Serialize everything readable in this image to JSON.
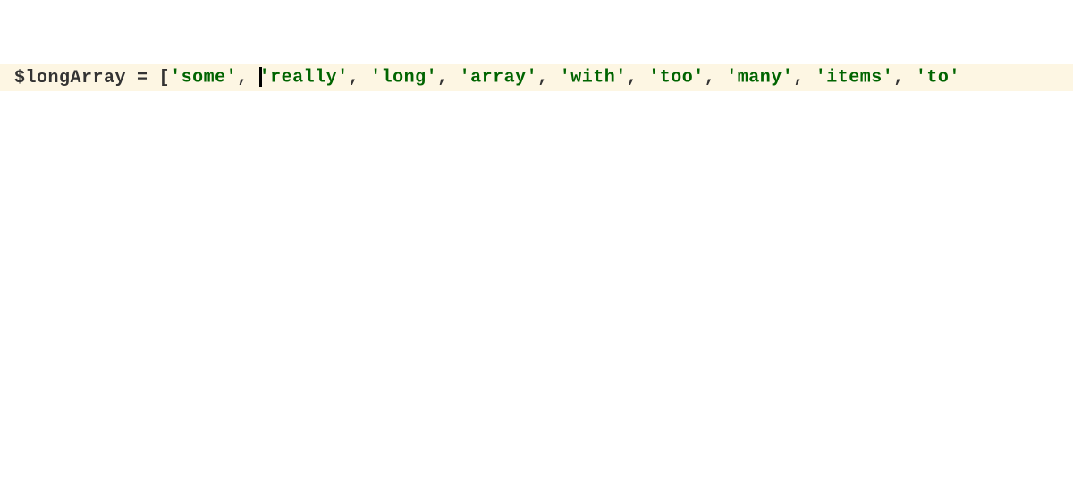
{
  "code": {
    "variable": "$longArray",
    "operator": "=",
    "bracket_open": "[",
    "items": [
      "'some'",
      "'really'",
      "'long'",
      "'array'",
      "'with'",
      "'too'",
      "'many'",
      "'items'",
      "'to'"
    ],
    "separator": ",",
    "cursor_position": 1
  },
  "colors": {
    "line_bg": "#fdf6e3",
    "string": "#006400",
    "default": "#333333"
  }
}
